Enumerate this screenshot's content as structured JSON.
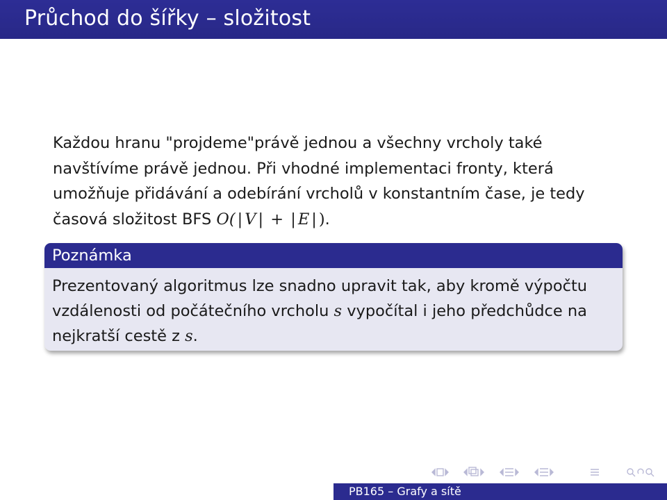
{
  "frame": {
    "title": "Průchod do šířky – složitost"
  },
  "paragraph": {
    "text_before_math": "Každou hranu \"projdeme\"právě jednou a všechny vrcholy také navštívíme právě jednou. Při vhodné implementaci fronty, která umožňuje přidávání a odebírání vrcholů v konstantním čase, je tedy časová složitost BFS ",
    "math_O": "O(",
    "math_bar": "|",
    "math_V": "V",
    "math_plus": " + ",
    "math_E": "E",
    "math_close": ")",
    "text_after_math": "."
  },
  "note_block": {
    "title": "Poznámka",
    "body_before_s1": "Prezentovaný algoritmus lze snadno upravit tak, aby kromě výpočtu vzdálenosti od počátečního vrcholu ",
    "s1": "s",
    "body_between": " vypočítal i jeho předchůdce na nejkratší cestě z ",
    "s2": "s",
    "body_end": "."
  },
  "footer": {
    "text": "PB165 – Grafy a sítě"
  },
  "colors": {
    "title_bar": "#2b2b8f",
    "block_body": "#e7e7f2",
    "nav_symbols": "#b9b9d6"
  },
  "icons": [
    "nav-slide-icon",
    "nav-frame-icon",
    "nav-subsection-icon",
    "nav-section-icon",
    "nav-align-icon",
    "nav-search-icon"
  ]
}
